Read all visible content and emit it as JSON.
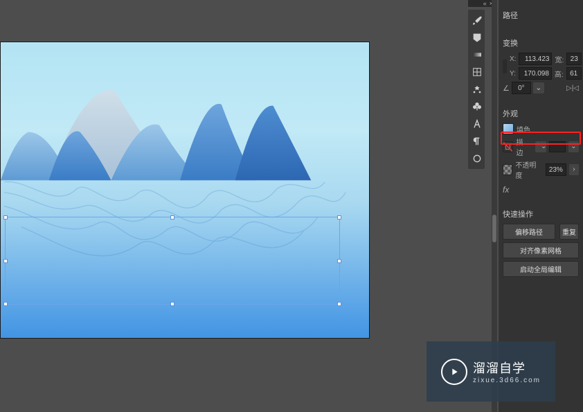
{
  "panel": {
    "path_label": "路径",
    "transform_label": "变换",
    "x_label": "X:",
    "x_value": "113.423",
    "y_label": "Y:",
    "y_value": "170.098",
    "w_label": "宽:",
    "w_value": "23",
    "h_label": "高:",
    "h_value": "61",
    "angle_label": "∠",
    "angle_value": "0°",
    "flip_sym": "▷|◁",
    "appearance_label": "外观",
    "fill_label": "填色",
    "stroke_label": "描边",
    "stroke_value": "",
    "opacity_label": "不透明度",
    "opacity_value": "23%",
    "fx_label": "fx",
    "quick_label": "快速操作",
    "btn_offset": "偏移路径",
    "btn_repeat": "重复",
    "btn_align": "对齐像素网格",
    "btn_isolate": "启动全局编辑"
  },
  "colors": {
    "fill_swatch": "linear-gradient(135deg,#b8d9f2 0%,#6fa8dc 100%)",
    "stroke_swatch": "#c33",
    "opacity_swatch": "repeating-conic-gradient(#888 0 25%, #555 0 50%) 50% / 8px 8px"
  },
  "watermark": {
    "main": "溜溜自学",
    "sub": "zixue.3d66.com"
  },
  "tools": [
    "brush-icon",
    "shape-icon",
    "gradient-icon",
    "grid-icon",
    "character-icon",
    "spiral-icon",
    "club-icon",
    "text-icon",
    "paragraph-icon",
    "circle-icon"
  ]
}
